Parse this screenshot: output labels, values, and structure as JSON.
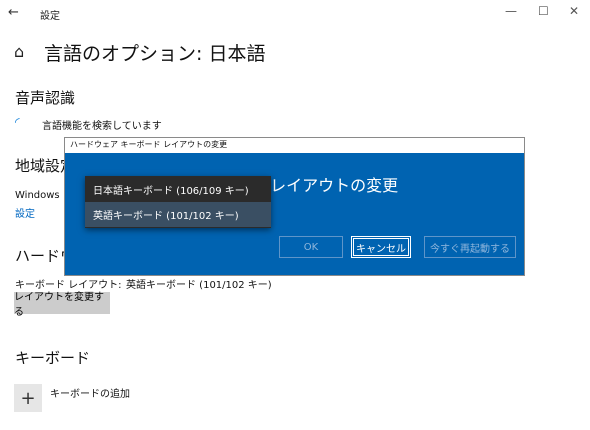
{
  "window": {
    "title": "設定",
    "back_icon": "←",
    "minimize_icon": "—",
    "maximize_icon": "☐",
    "close_icon": "✕"
  },
  "page": {
    "home_icon": "⌂",
    "title": "言語のオプション: 日本語"
  },
  "speech": {
    "heading": "音声認識",
    "spinner_icon": "◜",
    "status_text": "言語機能を検索しています"
  },
  "region": {
    "heading": "地域設定",
    "text_partial": "Windows は",
    "link": "設定"
  },
  "hardware": {
    "heading": "ハードウェア",
    "layout_label": "キーボード レイアウト:",
    "layout_value": "英語キーボード (101/102 キー)",
    "change_button": "レイアウトを変更する"
  },
  "keyboard": {
    "heading": "キーボード",
    "add_icon": "+",
    "add_label": "キーボードの追加"
  },
  "dialog": {
    "title": "ハードウェア キーボード レイアウトの変更",
    "heading": "ハードウェア キーボード レイアウトの変更",
    "ok_label": "OK",
    "cancel_label": "キャンセル",
    "restart_label": "今すぐ再起動する"
  },
  "dropdown": {
    "options": [
      "日本語キーボード (106/109 キー)",
      "英語キーボード (101/102 キー)"
    ],
    "selected_index": 1
  },
  "colors": {
    "accent": "#0063b1",
    "link": "#0067c0"
  }
}
